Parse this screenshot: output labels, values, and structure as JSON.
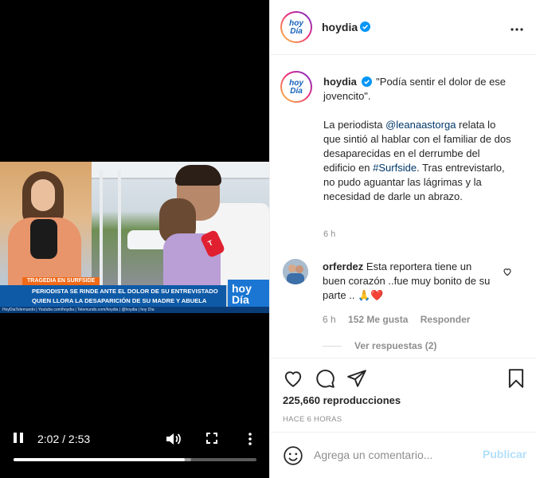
{
  "video": {
    "chyron_tag": "TRAGEDIA EN SURFSIDE",
    "chyron_line1": "PERIODISTA SE RINDE ANTE EL DOLOR DE SU ENTREVISTADO",
    "chyron_line2": "QUIEN LLORA LA DESAPARICIÓN DE SU MADRE Y ABUELA",
    "chyron_logo": "hoy Día",
    "ticker": "HoyDiaTelemundo  |  Youtube.com/hoydia  |  Telemundo.com/hoydia  |  @hoydia  |  hoy Día",
    "mic_flag": "T",
    "time": "2:02 / 2:53",
    "progress": 0.705,
    "buffered": 0.73
  },
  "post": {
    "username": "hoydia",
    "avatar_text": "hoy Día",
    "caption_quote": "\"Podía sentir el dolor de ese jovencito\".",
    "body_before_mention": "La periodista ",
    "mention": "@leanaastorga",
    "body_after_mention": " relata lo que sintió al hablar con el familiar de dos desaparecidas en el derrumbe del edificio en ",
    "hashtag": "#Surfside",
    "body_after_hashtag": ". Tras entrevistarlo, no pudo aguantar las lágrimas y la necesidad de darle un abrazo.",
    "caption_time": "6 h",
    "views": "225,660 reproducciones",
    "ago": "HACE 6 HORAS"
  },
  "comment": {
    "username": "orferdez",
    "text": "Esta reportera tiene un buen corazón ..fue muy bonito de su parte ..",
    "emojis": "🙏❤️",
    "time": "6 h",
    "likes": "152 Me gusta",
    "reply": "Responder",
    "view_replies": "Ver respuestas (2)"
  },
  "comment_box": {
    "placeholder": "Agrega un comentario...",
    "publish": "Publicar"
  },
  "colors": {
    "link": "#00376b",
    "verified": "#0095f6",
    "publish_disabled": "#b2dffc",
    "heart_red": "#ed4956"
  },
  "icons": {
    "header_more": "more-horizontal-icon",
    "verified": "verified-badge-icon",
    "like": "heart-icon",
    "comment": "comment-bubble-icon",
    "share": "paper-plane-icon",
    "save": "bookmark-icon",
    "emoji": "smiley-icon",
    "pause": "pause-icon",
    "volume": "volume-icon",
    "fullscreen": "fullscreen-icon",
    "video_more": "more-vertical-icon"
  }
}
